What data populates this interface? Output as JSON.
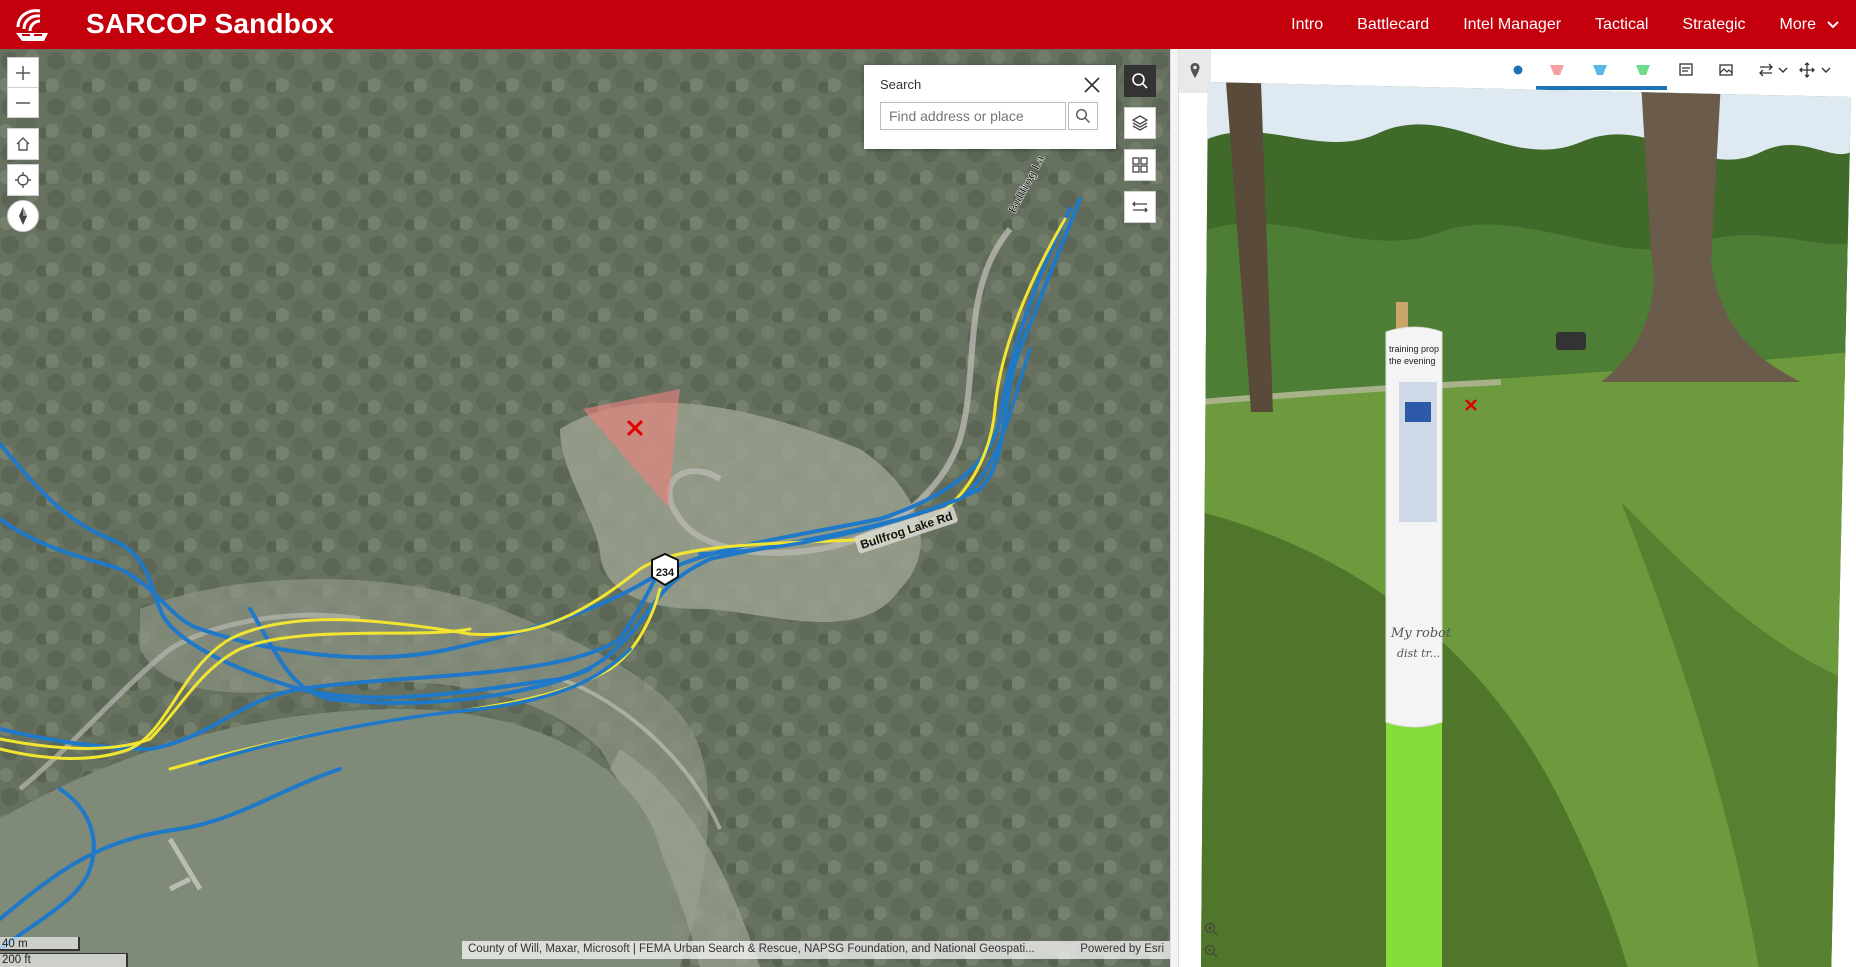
{
  "app": {
    "title": "SARCOP Sandbox"
  },
  "nav": {
    "items": [
      "Intro",
      "Battlecard",
      "Intel Manager",
      "Tactical",
      "Strategic"
    ],
    "more_label": "More"
  },
  "search": {
    "title": "Search",
    "placeholder": "Find address or place"
  },
  "map": {
    "road_label": "Bullfrog Lake Rd",
    "road_label_north": "Bullfrog La",
    "marker_label": "234",
    "attribution_left": "County of Will, Maxar, Microsoft | FEMA Urban Search & Rescue, NAPSG Foundation, and National Geospati...",
    "attribution_right": "Powered by Esri",
    "scale_metric": "40 m",
    "scale_imperial": "200 ft",
    "colors": {
      "route_blue": "#1f78c8",
      "route_yellow": "#f2e531",
      "view_cone": "#e8827c",
      "target_x": "#e00000"
    }
  },
  "photo": {
    "sign_text_1": "training prop",
    "sign_text_2": "the evening",
    "sign_handwriting_1": "My robot",
    "sign_handwriting_2": "dist tr..."
  },
  "icons": {
    "zoom_in": "plus-icon",
    "zoom_out": "minus-icon",
    "home": "home-icon",
    "locate": "locate-icon",
    "compass": "compass-icon",
    "search": "search-icon",
    "layers": "layers-icon",
    "basemap": "basemap-gallery-icon",
    "measure": "measure-icon",
    "pin": "pin-icon",
    "dot": "blue-dot-icon",
    "flag_red": "pink-marker-icon",
    "flag_blue": "blue-marker-icon",
    "flag_green": "green-marker-icon",
    "image": "image-icon",
    "image_gallery": "image-gallery-icon",
    "swap": "swap-icon",
    "chevron": "chevron-down-icon",
    "move": "move-icon"
  },
  "toolbar_colors": {
    "pink": "#f7a1a6",
    "blue": "#59b7e4",
    "green": "#6fdc8c",
    "dot": "#1a73b8"
  }
}
